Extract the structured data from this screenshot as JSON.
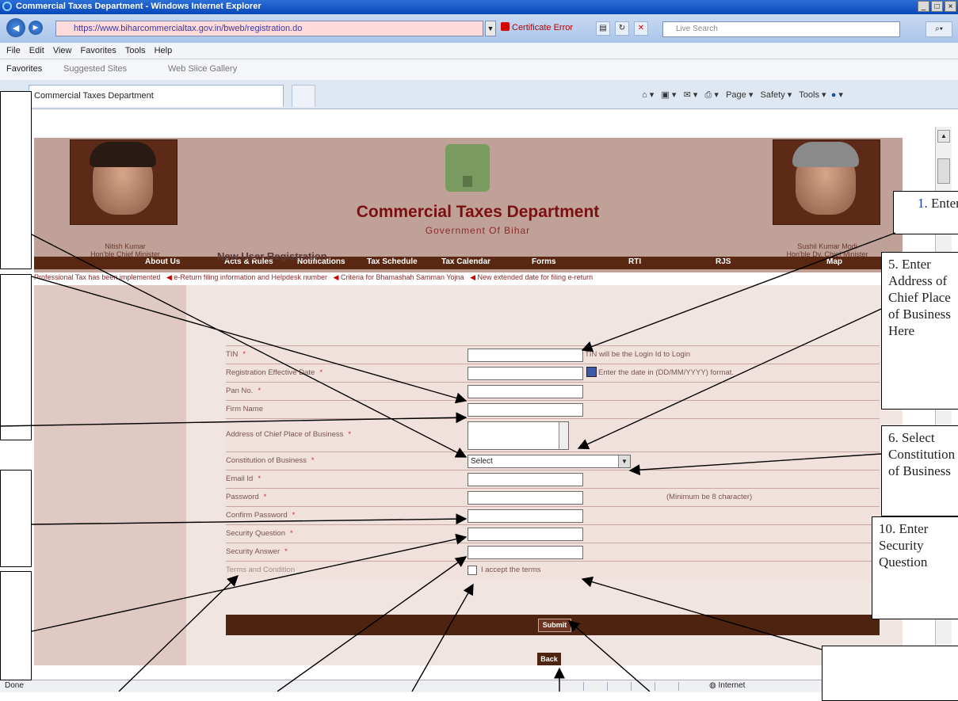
{
  "browser": {
    "window_title": "Commercial Taxes Department - Windows Internet Explorer",
    "address": "https://www.biharcommercialtax.gov.in/bweb/registration.do",
    "certificate_error": "Certificate Error",
    "live_search_placeholder": "Live Search",
    "menu": [
      "File",
      "Edit",
      "View",
      "Favorites",
      "Tools",
      "Help"
    ],
    "favorites": {
      "label": "Favorites",
      "suggested": "Suggested Sites",
      "web_slice": "Web Slice Gallery"
    },
    "tab_title": "Commercial Taxes Department",
    "command_bar": [
      "Page",
      "Safety",
      "Tools"
    ],
    "status_done": "Done",
    "status_zone": "Internet"
  },
  "site": {
    "title": "Commercial Taxes Department",
    "subtitle": "Government Of Bihar",
    "left_person": {
      "name": "Nitish Kumar",
      "role": "Hon'ble Chief Minister"
    },
    "right_person": {
      "name": "Sushil Kumar Modi",
      "role": "Hon'ble Dy. Chief Minister"
    },
    "nav": [
      "About Us",
      "Acts & Rules",
      "Notifications",
      "Tax Schedule",
      "Tax Calendar",
      "Forms",
      "RTI",
      "RJS",
      "Map"
    ],
    "ticker": [
      "Professional Tax has been implemented",
      "e-Return filing information and Helpdesk number",
      "Criteria for Bhamashah Samman Yojna",
      "New extended date for filing e-return"
    ]
  },
  "form": {
    "heading": "New User Registration",
    "fields": {
      "tin": "TIN",
      "reg_date": "Registration Effective Date",
      "pan": "Pan No.",
      "firm": "Firm Name",
      "address": "Address of Chief Place of Business",
      "constitution": "Constitution of Business",
      "email": "Email Id",
      "password": "Password",
      "confirm": "Confirm Password",
      "sec_q": "Security Question",
      "sec_a": "Security Answer",
      "terms": "Terms and Condition"
    },
    "required_mark": "*",
    "tin_hint": "TIN will be the Login Id to Login",
    "date_hint": "Enter the date in (DD/MM/YYYY) format.",
    "password_hint": "(Minimum be 8 character)",
    "constitution_selected": "Select",
    "accept_label": "I accept the terms",
    "submit": "Submit",
    "back": "Back"
  },
  "callouts": {
    "c1": {
      "num": "1.",
      "text": "Enter TIN"
    },
    "c5": "5. Enter Address of Chief Place of Business Here",
    "c6": "6. Select Constitution of Business",
    "c10": "10. Enter Security Question"
  }
}
